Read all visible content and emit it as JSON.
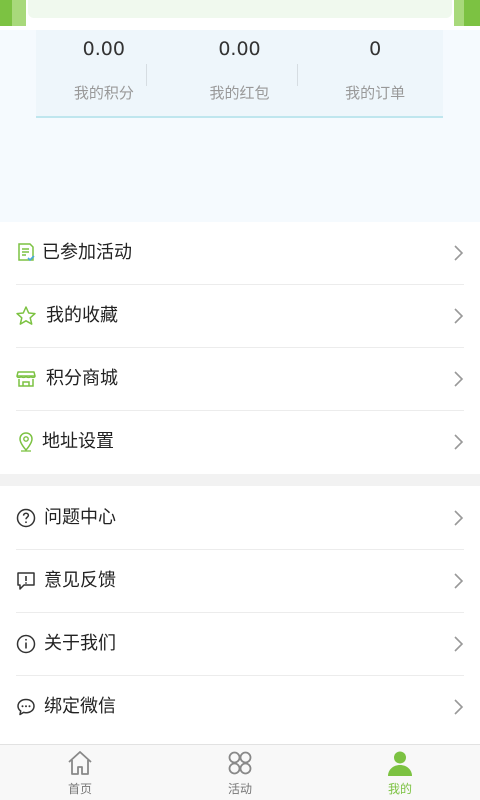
{
  "colors": {
    "accent": "#7cc242",
    "background_light": "#f5fafe",
    "divider": "#ececec"
  },
  "stats": [
    {
      "value": "0.00",
      "label": "我的积分"
    },
    {
      "value": "0.00",
      "label": "我的红包"
    },
    {
      "value": "0",
      "label": "我的订单"
    }
  ],
  "menu_group_1": [
    {
      "label": "已参加活动",
      "icon": "document-check-icon"
    },
    {
      "label": "我的收藏",
      "icon": "star-icon"
    },
    {
      "label": "积分商城",
      "icon": "store-icon"
    },
    {
      "label": "地址设置",
      "icon": "location-pin-icon"
    }
  ],
  "menu_group_2": [
    {
      "label": "问题中心",
      "icon": "question-circle-icon"
    },
    {
      "label": "意见反馈",
      "icon": "feedback-icon"
    },
    {
      "label": "关于我们",
      "icon": "info-circle-icon"
    },
    {
      "label": "绑定微信",
      "icon": "chat-bubble-icon"
    }
  ],
  "tabbar": [
    {
      "label": "首页",
      "icon": "home-icon",
      "active": false
    },
    {
      "label": "活动",
      "icon": "activity-grid-icon",
      "active": false
    },
    {
      "label": "我的",
      "icon": "user-icon",
      "active": true
    }
  ]
}
